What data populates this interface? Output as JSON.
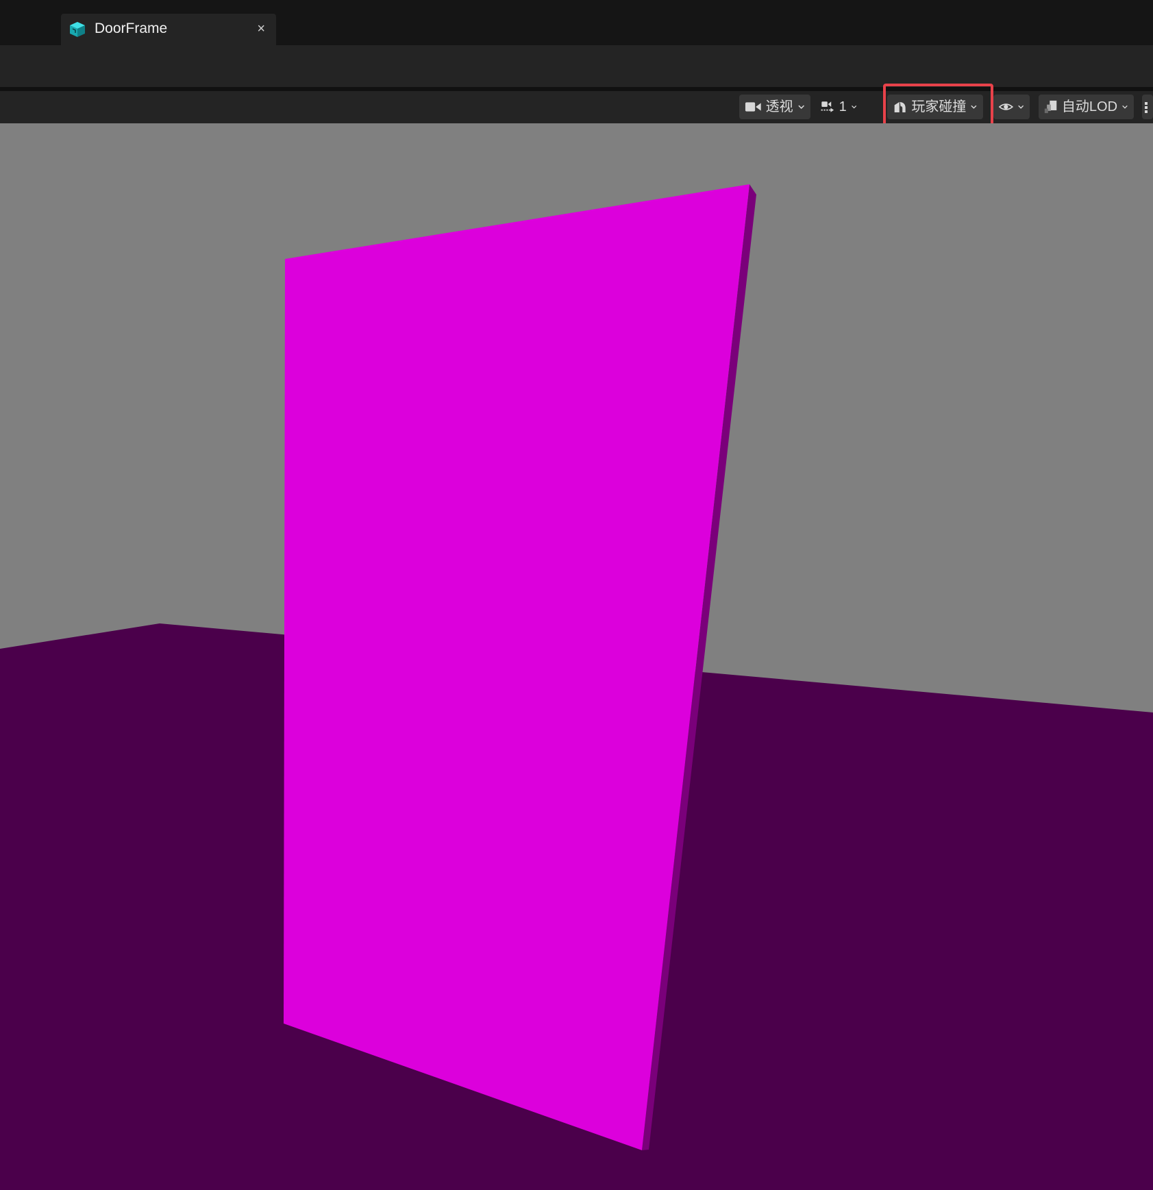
{
  "tab": {
    "title": "DoorFrame",
    "icon": "static-mesh-icon",
    "close_glyph": "×"
  },
  "viewport_toolbar": {
    "view_mode_label": "透视",
    "camera_speed_label": "1",
    "collision_label": "玩家碰撞",
    "lod_label": "自动LOD",
    "icons": [
      "video-camera-icon",
      "camera-speed-icon",
      "collision-icon",
      "eye-icon",
      "lod-icon",
      "grid-icon"
    ]
  },
  "colors": {
    "tab_accent": "#1fc8cf",
    "highlight_border": "#e8424a",
    "background_wall": "#808080",
    "floor": "#4b004b",
    "mesh_face": "#dc00dc",
    "mesh_side": "#7a007a"
  }
}
